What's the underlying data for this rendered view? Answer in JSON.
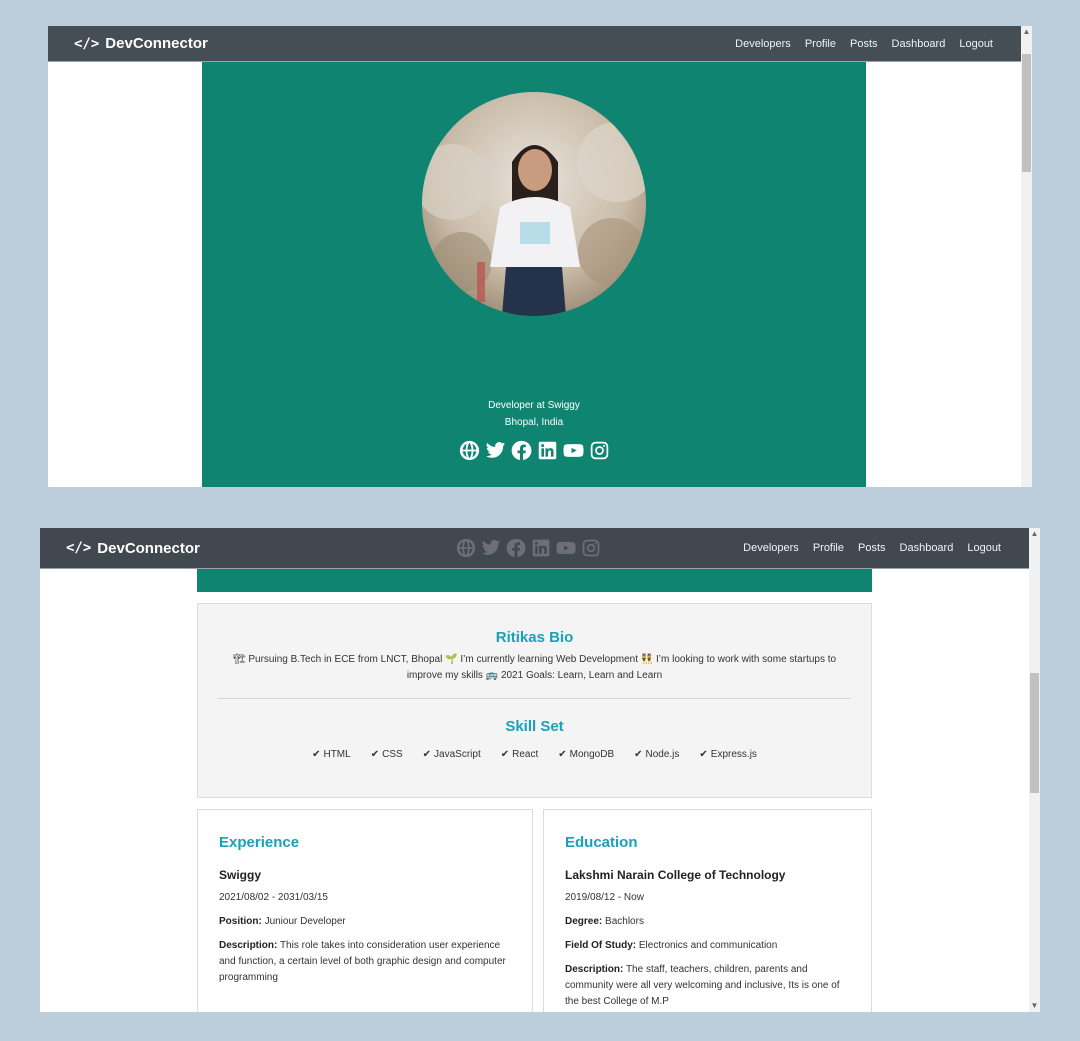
{
  "nav": {
    "brand": "DevConnector",
    "brand_code": "</>",
    "links": [
      "Developers",
      "Profile",
      "Posts",
      "Dashboard",
      "Logout"
    ]
  },
  "profile": {
    "role": "Developer at Swiggy",
    "location": "Bhopal, India",
    "social_icons": [
      "globe-icon",
      "twitter-icon",
      "facebook-icon",
      "linkedin-icon",
      "youtube-icon",
      "instagram-icon"
    ]
  },
  "bio": {
    "title": "Ritikas Bio",
    "text": "🏗 Pursuing B.Tech in ECE from LNCT, Bhopal 🌱 I’m currently learning Web Development 👯 I’m looking to work with some startups to improve my skills 🚌 2021 Goals: Learn, Learn and Learn"
  },
  "skills": {
    "title": "Skill Set",
    "items": [
      "HTML",
      "CSS",
      "JavaScript",
      "React",
      "MongoDB",
      "Node.js",
      "Express.js"
    ]
  },
  "experience": {
    "title": "Experience",
    "company": "Swiggy",
    "dates": "2021/08/02 - 2031/03/15",
    "position_label": "Position:",
    "position": "Juniour Developer",
    "description_label": "Description:",
    "description": "This role takes into consideration user experience and function, a certain level of both graphic design and computer programming"
  },
  "education": {
    "title": "Education",
    "school": "Lakshmi Narain College of Technology",
    "dates": "2019/08/12 - Now",
    "degree_label": "Degree:",
    "degree": "Bachlors",
    "field_label": "Field Of Study:",
    "field": "Electronics and communication",
    "description_label": "Description:",
    "description": "The staff, teachers, children, parents and community were all very welcoming and inclusive, Its is one of the best College of M.P"
  },
  "colors": {
    "navbar": "#454d55",
    "teal": "#0f8470",
    "accent": "#17a2b8",
    "backdrop": "#bccddc"
  }
}
